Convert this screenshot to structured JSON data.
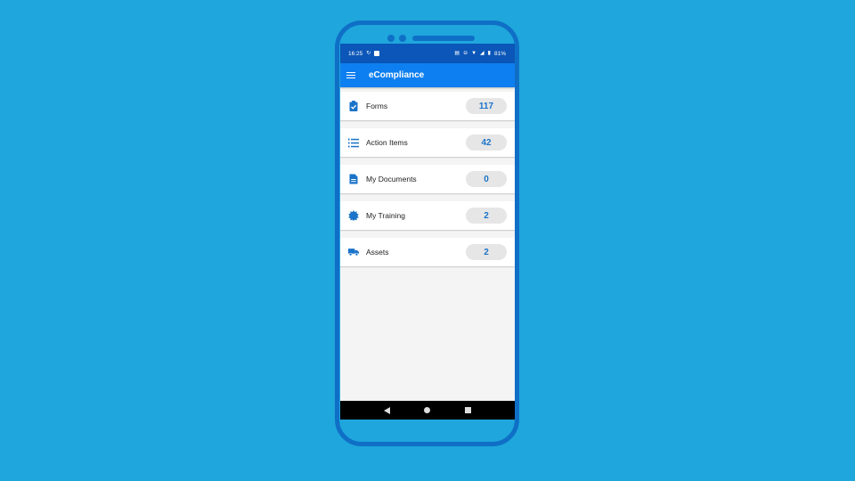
{
  "status_bar": {
    "time": "16:25",
    "battery": "81%"
  },
  "app_bar": {
    "title": "eCompliance",
    "menu_icon": "hamburger-menu-icon"
  },
  "colors": {
    "background": "#1fa6dc",
    "phone_frame": "#0f6fc6",
    "status_bar": "#0b56b8",
    "app_bar": "#0d7ff0",
    "accent": "#1a73c8",
    "pill": "#e6e6e6"
  },
  "items": [
    {
      "label": "Forms",
      "count": "117",
      "icon": "clipboard-check-icon"
    },
    {
      "label": "Action Items",
      "count": "42",
      "icon": "numbered-list-icon"
    },
    {
      "label": "My Documents",
      "count": "0",
      "icon": "document-icon"
    },
    {
      "label": "My Training",
      "count": "2",
      "icon": "badge-icon"
    },
    {
      "label": "Assets",
      "count": "2",
      "icon": "truck-icon"
    }
  ]
}
